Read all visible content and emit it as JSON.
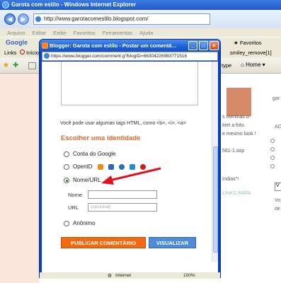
{
  "outer": {
    "title": "Garota com estilo - Windows Internet Explorer",
    "address": "http://www.garotacomestilo.blogspot.com/",
    "menu": [
      "Arquivo",
      "Editar",
      "Exibir",
      "Favoritos",
      "Ferramentas",
      "Ajuda"
    ],
    "google_label": "Google",
    "favorites_label": "Favoritos",
    "links_label": "Links",
    "inicio_label": "Início",
    "smiley_link": "smiley_remove[1]",
    "search_type": "type",
    "home_label": "Home",
    "page_fragments": {
      "gar": "gar",
      "meninas": "s meninas o-",
      "tirei": "tirei a foto.",
      "mesmo": "e mesmo look !",
      "asp": "561-1.asp",
      "indias": "índias\"!",
      "links_para": "LINKS PARA",
      "ac": "AC",
      "vo": "Vo",
      "de": "de",
      "v": "V"
    }
  },
  "popup": {
    "title": "Blogger: Garota com estilo - Postar um comentá...",
    "address": "https://www.blogger.com/comment.g?blogID=66304226983771516",
    "hint": "Você pode usar algumas tags HTML, como <b>, <i>, <a>",
    "section_title": "Escolher uma identidade",
    "options": {
      "google": "Conta do Google",
      "openid": "OpenID",
      "nome_url": "Nome/URL",
      "anonimo": "Anônimo"
    },
    "selected": "Nome/URL",
    "name_label": "Nome",
    "url_label": "URL",
    "url_placeholder": "(opcional)",
    "publish_button": "PUBLICAR COMENTÁRIO",
    "preview_button": "VISUALIZAR",
    "status_zone": "Internet",
    "zoom": "100%"
  },
  "colors": {
    "accent": "#e0662a",
    "publish": "#f26a10",
    "preview": "#4f8cd8",
    "annotation_arrow": "#e0121a"
  }
}
